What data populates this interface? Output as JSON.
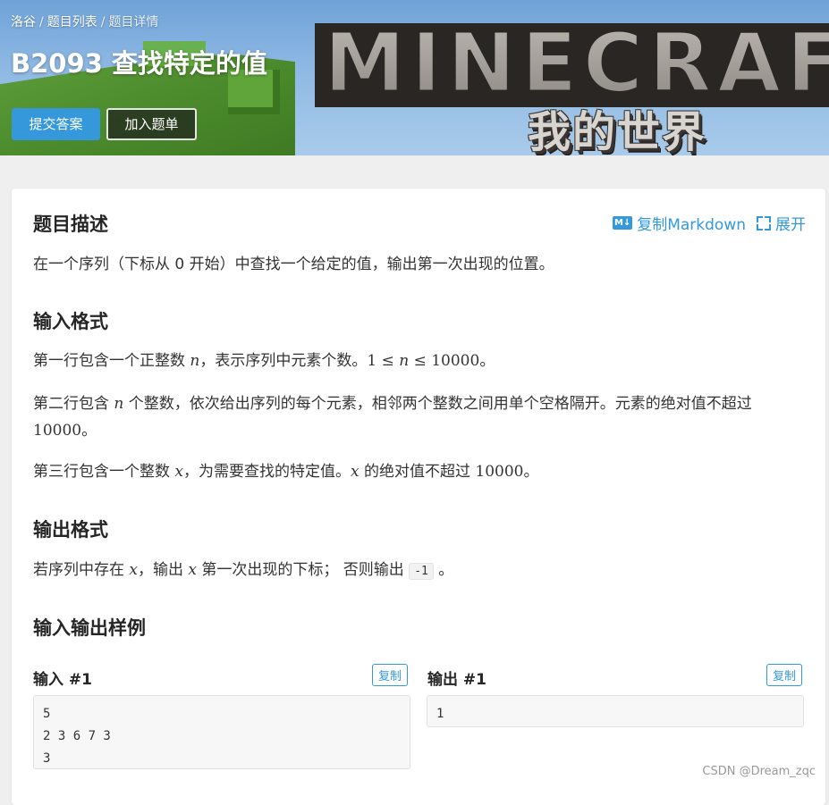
{
  "banner": {
    "breadcrumb": [
      "洛谷",
      "题目列表",
      "题目详情"
    ],
    "breadcrumb_sep": "/",
    "title": "B2093 查找特定的值",
    "submit_label": "提交答案",
    "add_label": "加入题单",
    "logo_text": "MINECRAFT",
    "logo_subtitle": "我的世界"
  },
  "toolbar": {
    "copy_markdown": "复制Markdown",
    "expand": "展开"
  },
  "sections": {
    "desc_title": "题目描述",
    "desc_text": "在一个序列（下标从 0 开始）中查找一个给定的值，输出第一次出现的位置。",
    "input_title": "输入格式",
    "input_p1_a": "第一行包含一个正整数 ",
    "input_p1_var": "n",
    "input_p1_b": "，表示序列中元素个数。",
    "input_p1_math_a": "1 ≤ ",
    "input_p1_math_var": "n",
    "input_p1_math_b": " ≤ 10000",
    "input_p1_end": "。",
    "input_p2_a": "第二行包含 ",
    "input_p2_var": "n",
    "input_p2_b": " 个整数，依次给出序列的每个元素，相邻两个整数之间用单个空格隔开。元素的绝对值不超过 ",
    "input_p2_num": "10000",
    "input_p2_end": "。",
    "input_p3_a": "第三行包含一个整数 ",
    "input_p3_var": "x",
    "input_p3_b": "，为需要查找的特定值。",
    "input_p3_var2": "x",
    "input_p3_c": " 的绝对值不超过 ",
    "input_p3_num": "10000",
    "input_p3_end": "。",
    "output_title": "输出格式",
    "output_a": "若序列中存在 ",
    "output_var": "x",
    "output_b": "，输出 ",
    "output_var2": "x",
    "output_c": " 第一次出现的下标； 否则输出 ",
    "output_code": "-1",
    "output_end": " 。",
    "samples_title": "输入输出样例"
  },
  "samples": {
    "input_label": "输入 #1",
    "output_label": "输出 #1",
    "copy_label": "复制",
    "input_content": "5\n2 3 6 7 3\n3",
    "output_content": "1"
  },
  "watermark": "CSDN @Dream_zqc",
  "colors": {
    "accent": "#3498db",
    "page_bg": "#efefef",
    "card_bg": "#ffffff"
  }
}
